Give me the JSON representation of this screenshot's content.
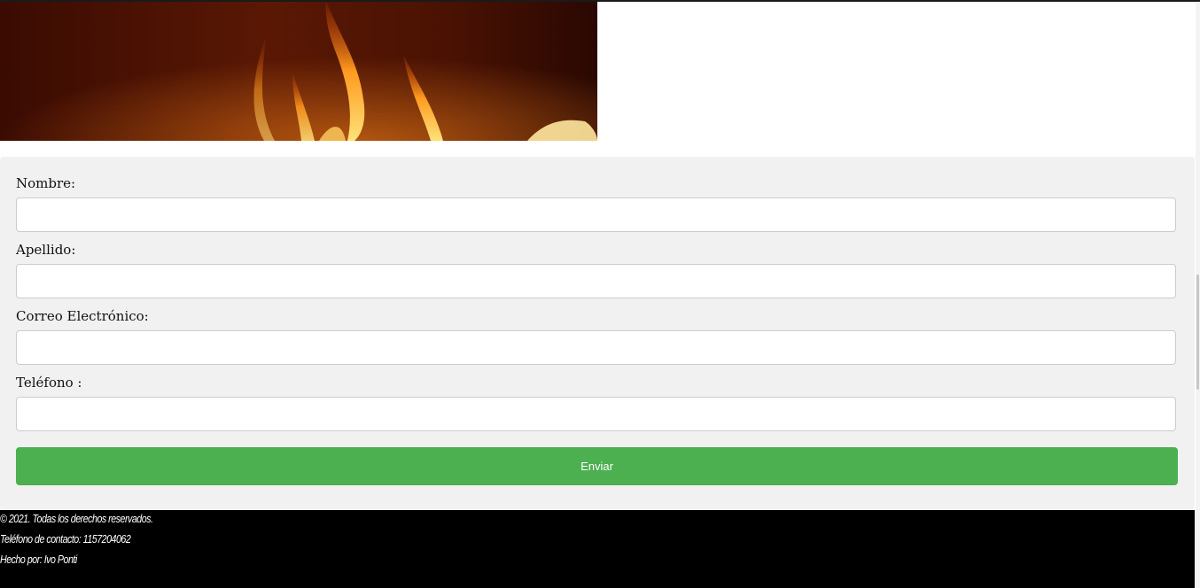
{
  "form": {
    "fields": [
      {
        "label": "Nombre:",
        "value": "",
        "placeholder": ""
      },
      {
        "label": "Apellido:",
        "value": "",
        "placeholder": ""
      },
      {
        "label": "Correo Electrónico:",
        "value": "",
        "placeholder": ""
      },
      {
        "label": "Teléfono :",
        "value": "",
        "placeholder": ""
      }
    ],
    "submit_label": "Enviar"
  },
  "footer": {
    "copyright": "© 2021. Todas los derechos reservados.",
    "phone": "Teléfono de contacto: 1157204062",
    "author": "Hecho por: Ivo Ponti"
  },
  "colors": {
    "submit_button": "#4caf50",
    "form_panel": "#f1f1f1",
    "footer": "#000000"
  }
}
